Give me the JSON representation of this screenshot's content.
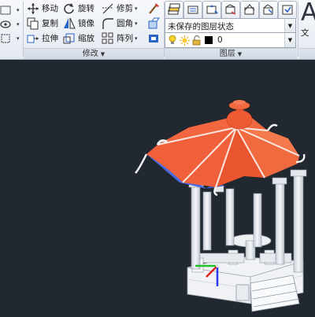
{
  "modify": {
    "title": "修改",
    "move": "移动",
    "rotate": "旋转",
    "trim": "修剪",
    "copy": "复制",
    "mirror": "镜像",
    "fillet": "圆角",
    "stretch": "拉伸",
    "scale": "缩放",
    "array": "阵列"
  },
  "layers": {
    "title": "图层",
    "layer_state": "未保存的图层状态",
    "current_layer": "0",
    "current_layer_color": "#000000"
  },
  "annotation": {
    "big_letter": "A",
    "text_label": "文"
  },
  "colors": {
    "viewport_bg": "#212830",
    "roof": "#f0603a",
    "column": "#e6e9ee",
    "axis_x": "#e02020",
    "axis_y": "#22c02a",
    "axis_z": "#2a3cf0"
  }
}
